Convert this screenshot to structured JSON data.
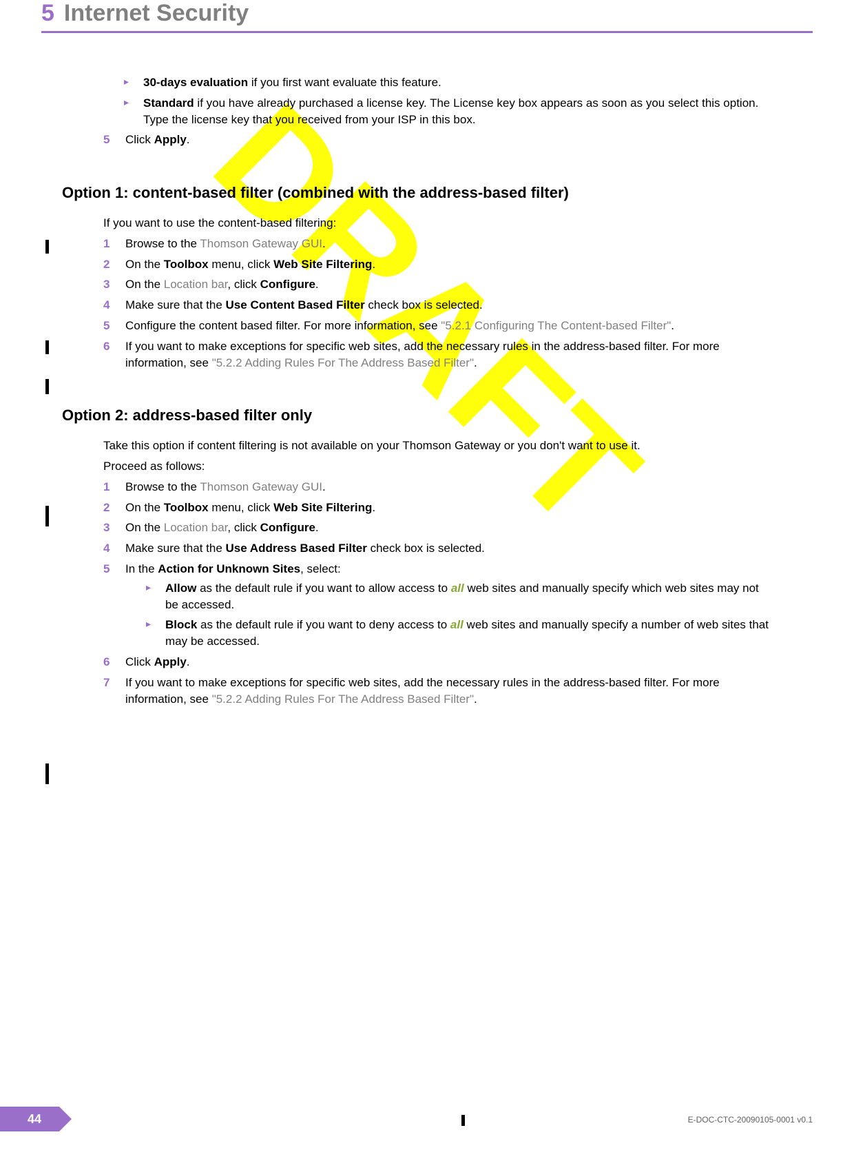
{
  "header": {
    "chapter_num": "5",
    "chapter_title": "Internet Security"
  },
  "watermark": "DRAFT",
  "top_bullets": {
    "b0": {
      "bold": "30-days evaluation",
      "rest": " if you first want evaluate this feature."
    },
    "b1": {
      "bold": "Standard",
      "rest": " if you have already purchased a license key. The License key box appears as soon as you select this option. Type the license key that you received from your ISP in this box."
    }
  },
  "top_step5": {
    "num": "5",
    "pre": "Click ",
    "bold": "Apply",
    "post": "."
  },
  "option1": {
    "heading": "Option 1: content-based filter (combined with the address-based filter)",
    "intro": "If you want to use the content-based filtering:",
    "s1": {
      "num": "1",
      "pre": "Browse to the ",
      "link": "Thomson Gateway GUI",
      "post": "."
    },
    "s2": {
      "num": "2",
      "pre": "On the ",
      "b1": "Toolbox",
      "mid": " menu, click ",
      "b2": "Web Site Filtering",
      "post": "."
    },
    "s3": {
      "num": "3",
      "pre": "On the ",
      "link": "Location bar",
      "mid": ", click ",
      "b1": "Configure",
      "post": "."
    },
    "s4": {
      "num": "4",
      "pre": "Make sure that the ",
      "b1": "Use Content Based Filter",
      "post": " check box is selected."
    },
    "s5": {
      "num": "5",
      "pre": "Configure the content based filter. For more information, see ",
      "link": "\"5.2.1 Configuring The Content-based Filter\"",
      "post": "."
    },
    "s6": {
      "num": "6",
      "pre": "If you want to make exceptions for specific web sites, add the necessary rules in the address-based filter. For more information, see ",
      "link": "\"5.2.2 Adding Rules For The Address Based Filter\"",
      "post": "."
    }
  },
  "option2": {
    "heading": "Option 2: address-based filter only",
    "intro1": "Take this option if content filtering is not available on your Thomson Gateway or you don't want to use it.",
    "intro2": "Proceed as follows:",
    "s1": {
      "num": "1",
      "pre": "Browse to the ",
      "link": "Thomson Gateway GUI",
      "post": "."
    },
    "s2": {
      "num": "2",
      "pre": "On the ",
      "b1": "Toolbox",
      "mid": " menu, click ",
      "b2": "Web Site Filtering",
      "post": "."
    },
    "s3": {
      "num": "3",
      "pre": "On the ",
      "link": "Location bar",
      "mid": ", click ",
      "b1": "Configure",
      "post": "."
    },
    "s4": {
      "num": "4",
      "pre": "Make sure that the ",
      "b1": "Use Address Based Filter",
      "post": " check box is selected."
    },
    "s5": {
      "num": "5",
      "pre": "In the ",
      "b1": "Action for Unknown Sites",
      "post": ", select:"
    },
    "s5a": {
      "b1": "Allow",
      "mid": " as the default rule if you want to allow access to ",
      "em": "all",
      "post": " web sites and manually specify which web sites may not be accessed."
    },
    "s5b": {
      "b1": "Block",
      "mid": " as the default rule if you want to deny access to ",
      "em": "all",
      "post": " web sites and manually specify a number of web sites that may be accessed."
    },
    "s6": {
      "num": "6",
      "pre": "Click ",
      "b1": "Apply",
      "post": "."
    },
    "s7": {
      "num": "7",
      "pre": "If you want to make exceptions for specific web sites, add the necessary rules in the address-based filter. For more information, see ",
      "link": "\"5.2.2 Adding Rules For The Address Based Filter\"",
      "post": "."
    }
  },
  "footer": {
    "page": "44",
    "doc": "E-DOC-CTC-20090105-0001 v0.1"
  }
}
